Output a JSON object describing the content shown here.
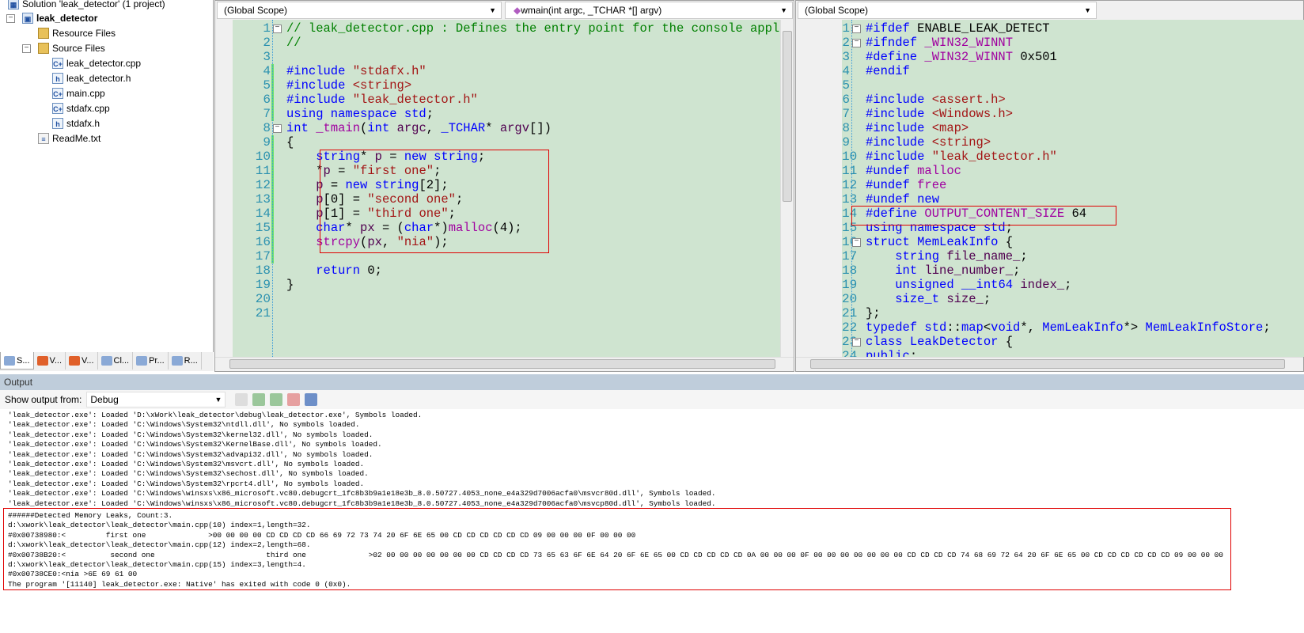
{
  "solution_explorer": {
    "items": [
      {
        "label": "Solution 'leak_detector' (1 project)",
        "icon": "solution-icon",
        "level": 0,
        "bold": false
      },
      {
        "label": "leak_detector",
        "icon": "project-icon",
        "level": 0,
        "bold": true
      },
      {
        "label": "Resource Files",
        "icon": "folder-icon",
        "level": 1,
        "bold": false
      },
      {
        "label": "Source Files",
        "icon": "folder-open-icon",
        "level": 1,
        "bold": false
      },
      {
        "label": "leak_detector.cpp",
        "icon": "cpp-file-icon",
        "level": 2,
        "bold": false
      },
      {
        "label": "leak_detector.h",
        "icon": "header-file-icon",
        "level": 2,
        "bold": false
      },
      {
        "label": "main.cpp",
        "icon": "cpp-file-icon",
        "level": 2,
        "bold": false
      },
      {
        "label": "stdafx.cpp",
        "icon": "cpp-file-icon",
        "level": 2,
        "bold": false
      },
      {
        "label": "stdafx.h",
        "icon": "header-file-icon",
        "level": 2,
        "bold": false
      },
      {
        "label": "ReadMe.txt",
        "icon": "text-file-icon",
        "level": 1,
        "bold": false
      }
    ],
    "tabs": [
      "S...",
      "V...",
      "V...",
      "Cl...",
      "Pr...",
      "R..."
    ]
  },
  "left_editor": {
    "scope": "(Global Scope)",
    "function": "wmain(int argc, _TCHAR *[] argv)",
    "lines": [
      [
        [
          "c",
          "// leak_detector.cpp : Defines the entry point for the console application."
        ]
      ],
      [
        [
          "c",
          "//"
        ]
      ],
      [],
      [
        [
          "k",
          "#include "
        ],
        [
          "s",
          "\"stdafx.h\""
        ]
      ],
      [
        [
          "k",
          "#include "
        ],
        [
          "s",
          "<string>"
        ]
      ],
      [
        [
          "k",
          "#include "
        ],
        [
          "s",
          "\"leak_detector.h\""
        ]
      ],
      [
        [
          "k",
          "using namespace "
        ],
        [
          "k",
          "std"
        ],
        [
          "n",
          ";"
        ]
      ],
      [
        [
          "k",
          "int "
        ],
        [
          "m",
          "_tmain"
        ],
        [
          "n",
          "("
        ],
        [
          "k",
          "int "
        ],
        [
          "v",
          "argc"
        ],
        [
          "n",
          ", "
        ],
        [
          "k",
          "_TCHAR"
        ],
        [
          "n",
          "* "
        ],
        [
          "v",
          "argv"
        ],
        [
          "n",
          "[])"
        ]
      ],
      [
        [
          "n",
          "{"
        ]
      ],
      [
        [
          "n",
          "    "
        ],
        [
          "k",
          "string"
        ],
        [
          "n",
          "* "
        ],
        [
          "v",
          "p"
        ],
        [
          "n",
          " = "
        ],
        [
          "k",
          "new string"
        ],
        [
          "n",
          ";"
        ]
      ],
      [
        [
          "n",
          "    *"
        ],
        [
          "v",
          "p"
        ],
        [
          "n",
          " = "
        ],
        [
          "s",
          "\"first one\""
        ],
        [
          "n",
          ";"
        ]
      ],
      [
        [
          "n",
          "    "
        ],
        [
          "v",
          "p"
        ],
        [
          "n",
          " = "
        ],
        [
          "k",
          "new string"
        ],
        [
          "n",
          "[2];"
        ]
      ],
      [
        [
          "n",
          "    "
        ],
        [
          "v",
          "p"
        ],
        [
          "n",
          "[0] = "
        ],
        [
          "s",
          "\"second one\""
        ],
        [
          "n",
          ";"
        ]
      ],
      [
        [
          "n",
          "    "
        ],
        [
          "v",
          "p"
        ],
        [
          "n",
          "[1] = "
        ],
        [
          "s",
          "\"third one\""
        ],
        [
          "n",
          ";"
        ]
      ],
      [
        [
          "n",
          "    "
        ],
        [
          "k",
          "char"
        ],
        [
          "n",
          "* "
        ],
        [
          "v",
          "px"
        ],
        [
          "n",
          " = ("
        ],
        [
          "k",
          "char"
        ],
        [
          "n",
          "*)"
        ],
        [
          "m",
          "malloc"
        ],
        [
          "n",
          "(4);"
        ]
      ],
      [
        [
          "n",
          "    "
        ],
        [
          "m",
          "strcpy"
        ],
        [
          "n",
          "("
        ],
        [
          "v",
          "px"
        ],
        [
          "n",
          ", "
        ],
        [
          "s",
          "\"nia\""
        ],
        [
          "n",
          ");"
        ]
      ],
      [],
      [
        [
          "n",
          "    "
        ],
        [
          "k",
          "return "
        ],
        [
          "n",
          "0;"
        ]
      ],
      [
        [
          "n",
          "}"
        ]
      ],
      [],
      []
    ]
  },
  "right_editor": {
    "scope": "(Global Scope)",
    "lines": [
      [
        [
          "k",
          "#ifdef "
        ],
        [
          "n",
          "ENABLE_LEAK_DETECT"
        ]
      ],
      [
        [
          "k",
          "#ifndef "
        ],
        [
          "m",
          "_WIN32_WINNT"
        ]
      ],
      [
        [
          "k",
          "#define "
        ],
        [
          "m",
          "_WIN32_WINNT"
        ],
        [
          "n",
          " 0x501"
        ]
      ],
      [
        [
          "k",
          "#endif"
        ]
      ],
      [],
      [
        [
          "k",
          "#include "
        ],
        [
          "s",
          "<assert.h>"
        ]
      ],
      [
        [
          "k",
          "#include "
        ],
        [
          "s",
          "<Windows.h>"
        ]
      ],
      [
        [
          "k",
          "#include "
        ],
        [
          "s",
          "<map>"
        ]
      ],
      [
        [
          "k",
          "#include "
        ],
        [
          "s",
          "<string>"
        ]
      ],
      [
        [
          "k",
          "#include "
        ],
        [
          "s",
          "\"leak_detector.h\""
        ]
      ],
      [
        [
          "k",
          "#undef "
        ],
        [
          "m",
          "malloc"
        ]
      ],
      [
        [
          "k",
          "#undef "
        ],
        [
          "m",
          "free"
        ]
      ],
      [
        [
          "k",
          "#undef "
        ],
        [
          "k",
          "new"
        ]
      ],
      [
        [
          "k",
          "#define "
        ],
        [
          "m",
          "OUTPUT_CONTENT_SIZE"
        ],
        [
          "n",
          " 64"
        ]
      ],
      [
        [
          "k",
          "using namespace std"
        ],
        [
          "n",
          ";"
        ]
      ],
      [
        [
          "k",
          "struct "
        ],
        [
          "k",
          "MemLeakInfo"
        ],
        [
          "n",
          " {"
        ]
      ],
      [
        [
          "n",
          "    "
        ],
        [
          "k",
          "string "
        ],
        [
          "v",
          "file_name_"
        ],
        [
          "n",
          ";"
        ]
      ],
      [
        [
          "n",
          "    "
        ],
        [
          "k",
          "int "
        ],
        [
          "v",
          "line_number_"
        ],
        [
          "n",
          ";"
        ]
      ],
      [
        [
          "n",
          "    "
        ],
        [
          "k",
          "unsigned __int64 "
        ],
        [
          "v",
          "index_"
        ],
        [
          "n",
          ";"
        ]
      ],
      [
        [
          "n",
          "    "
        ],
        [
          "k",
          "size_t "
        ],
        [
          "v",
          "size_"
        ],
        [
          "n",
          ";"
        ]
      ],
      [
        [
          "n",
          "};"
        ]
      ],
      [
        [
          "k",
          "typedef "
        ],
        [
          "k",
          "std"
        ],
        [
          "n",
          "::"
        ],
        [
          "k",
          "map"
        ],
        [
          "n",
          "<"
        ],
        [
          "k",
          "void"
        ],
        [
          "n",
          "*, "
        ],
        [
          "k",
          "MemLeakInfo"
        ],
        [
          "n",
          "*> "
        ],
        [
          "k",
          "MemLeakInfoStore"
        ],
        [
          "n",
          ";"
        ]
      ],
      [
        [
          "k",
          "class "
        ],
        [
          "k",
          "LeakDetector"
        ],
        [
          "n",
          " {"
        ]
      ],
      [
        [
          "k",
          "public"
        ],
        [
          "n",
          ":"
        ]
      ]
    ]
  },
  "output": {
    "title": "Output",
    "show_from_label": "Show output from:",
    "show_from_value": "Debug",
    "lines": [
      "'leak_detector.exe': Loaded 'D:\\xWork\\leak_detector\\debug\\leak_detector.exe', Symbols loaded.",
      "'leak_detector.exe': Loaded 'C:\\Windows\\System32\\ntdll.dll', No symbols loaded.",
      "'leak_detector.exe': Loaded 'C:\\Windows\\System32\\kernel32.dll', No symbols loaded.",
      "'leak_detector.exe': Loaded 'C:\\Windows\\System32\\KernelBase.dll', No symbols loaded.",
      "'leak_detector.exe': Loaded 'C:\\Windows\\System32\\advapi32.dll', No symbols loaded.",
      "'leak_detector.exe': Loaded 'C:\\Windows\\System32\\msvcrt.dll', No symbols loaded.",
      "'leak_detector.exe': Loaded 'C:\\Windows\\System32\\sechost.dll', No symbols loaded.",
      "'leak_detector.exe': Loaded 'C:\\Windows\\System32\\rpcrt4.dll', No symbols loaded.",
      "'leak_detector.exe': Loaded 'C:\\Windows\\winsxs\\x86_microsoft.vc80.debugcrt_1fc8b3b9a1e18e3b_8.0.50727.4053_none_e4a329d7006acfa0\\msvcr80d.dll', Symbols loaded.",
      "'leak_detector.exe': Loaded 'C:\\Windows\\winsxs\\x86_microsoft.vc80.debugcrt_1fc8b3b9a1e18e3b_8.0.50727.4053_none_e4a329d7006acfa0\\msvcp80d.dll', Symbols loaded.",
      "######Detected Memory Leaks, Count:3.",
      "d:\\xwork\\leak_detector\\leak_detector\\main.cpp(10) index=1,length=32.",
      "#0x00738980:<         first one              >00 00 00 00 CD CD CD CD 66 69 72 73 74 20 6F 6E 65 00 CD CD CD CD CD CD 09 00 00 00 0F 00 00 00",
      "d:\\xwork\\leak_detector\\leak_detector\\main.cpp(12) index=2,length=68.",
      "#0x00738B20:<          second one                         third one              >02 00 00 00 00 00 00 00 CD CD CD CD 73 65 63 6F 6E 64 20 6F 6E 65 00 CD CD CD CD CD 0A 00 00 00 0F 00 00 00 00 00 00 00 CD CD CD CD 74 68 69 72 64 20 6F 6E 65 00 CD CD CD CD CD CD 09 00 00 00",
      "d:\\xwork\\leak_detector\\leak_detector\\main.cpp(15) index=3,length=4.",
      "#0x00738CE0:<nia >6E 69 61 00",
      "The program '[11140] leak_detector.exe: Native' has exited with code 0 (0x0)."
    ]
  },
  "colors": {
    "editor_bg": "#cfe4d0",
    "keyword": "#0000ff",
    "string": "#a31515",
    "comment": "#008000",
    "highlight_box": "#e00000",
    "line_number": "#2b91af"
  }
}
